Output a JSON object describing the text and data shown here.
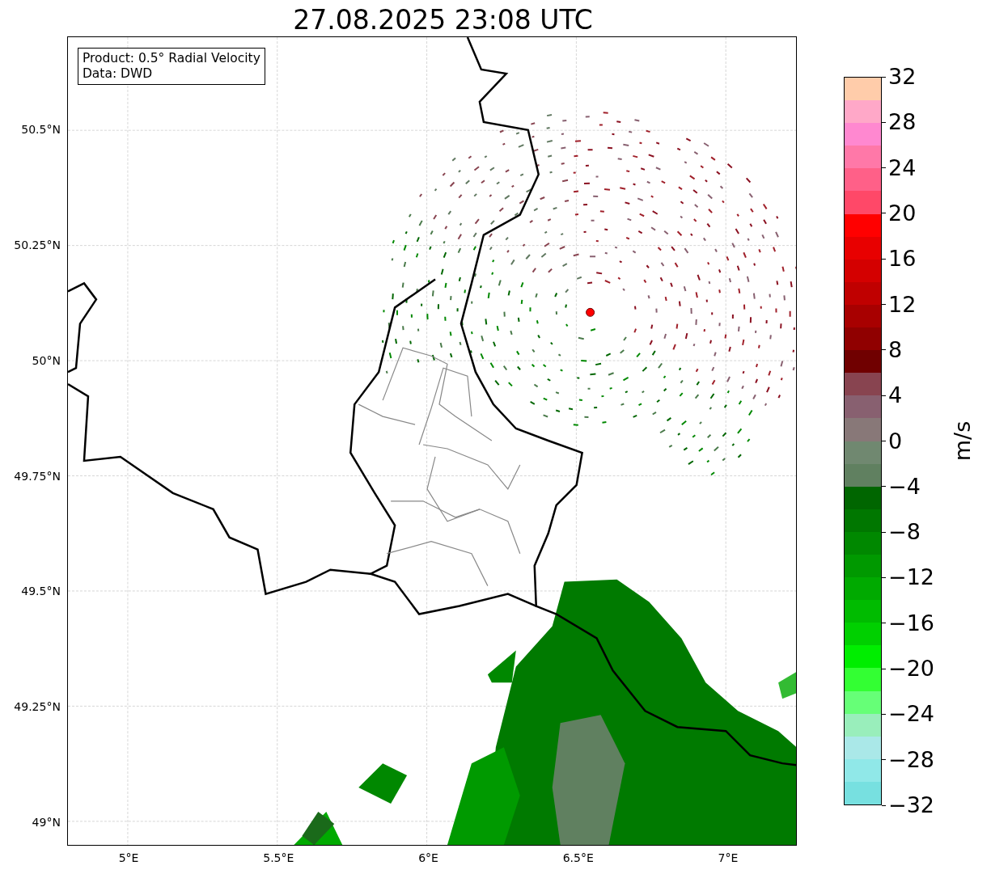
{
  "title": "27.08.2025 23:08 UTC",
  "info_box": {
    "lines": [
      "Product: 0.5° Radial Velocity",
      "Data: DWD"
    ]
  },
  "map": {
    "xticks": [
      {
        "label": "5°E"
      },
      {
        "label": "5.5°E"
      },
      {
        "label": "6°E"
      },
      {
        "label": "6.5°E"
      },
      {
        "label": "7°E"
      }
    ],
    "yticks": [
      {
        "label": "50.5°N"
      },
      {
        "label": "50.25°N"
      },
      {
        "label": "50°N"
      },
      {
        "label": "49.75°N"
      },
      {
        "label": "49.5°N"
      },
      {
        "label": "49.25°N"
      },
      {
        "label": "49°N"
      }
    ]
  },
  "colorbar": {
    "label": "m/s",
    "ticks": [
      "32",
      "28",
      "24",
      "20",
      "16",
      "12",
      "8",
      "4",
      "0",
      "−4",
      "−8",
      "−12",
      "−16",
      "−20",
      "−24",
      "−28",
      "−32"
    ],
    "segments": [
      {
        "color": "#ffccaa"
      },
      {
        "color": "#ffa8c8"
      },
      {
        "color": "#ff88d0"
      },
      {
        "color": "#ff78a8"
      },
      {
        "color": "#ff6088"
      },
      {
        "color": "#ff4868"
      },
      {
        "color": "#ff0000"
      },
      {
        "color": "#e80000"
      },
      {
        "color": "#d40000"
      },
      {
        "color": "#c00000"
      },
      {
        "color": "#a80000"
      },
      {
        "color": "#900000"
      },
      {
        "color": "#700000"
      },
      {
        "color": "#884450"
      },
      {
        "color": "#886070"
      },
      {
        "color": "#887878"
      },
      {
        "color": "#708870"
      },
      {
        "color": "#608060"
      },
      {
        "color": "#006600"
      },
      {
        "color": "#007700"
      },
      {
        "color": "#008800"
      },
      {
        "color": "#009900"
      },
      {
        "color": "#00aa00"
      },
      {
        "color": "#00bb00"
      },
      {
        "color": "#00d000"
      },
      {
        "color": "#00ee00"
      },
      {
        "color": "#33ff33"
      },
      {
        "color": "#66ff77"
      },
      {
        "color": "#99eebb"
      },
      {
        "color": "#aae8e8"
      },
      {
        "color": "#90e8e8"
      },
      {
        "color": "#77e0e0"
      }
    ]
  }
}
